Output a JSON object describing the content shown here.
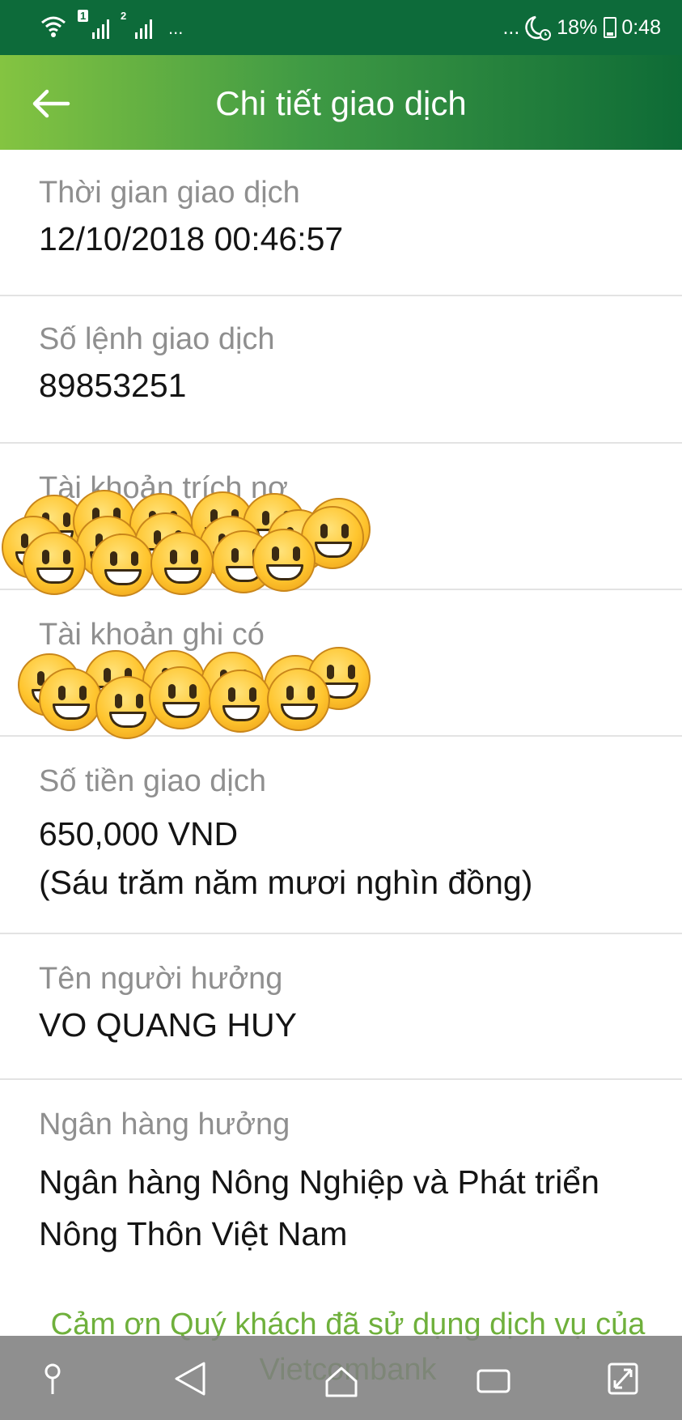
{
  "status_bar": {
    "sim1": "1",
    "sim2": "2",
    "left_dots": "...",
    "right_dots": "...",
    "battery_percent": "18%",
    "time": "0:48",
    "icons": [
      "wifi-icon",
      "signal-sim1-icon",
      "signal-sim2-icon",
      "moon-alarm-icon",
      "battery-icon"
    ]
  },
  "header": {
    "title": "Chi tiết giao dịch",
    "back_icon": "arrow-left-icon"
  },
  "details": {
    "time_label": "Thời gian giao dịch",
    "time_value": "12/10/2018 00:46:57",
    "order_label": "Số lệnh giao dịch",
    "order_value": "89853251",
    "debit_label": "Tài khoản trích nợ",
    "credit_label": "Tài khoản ghi có",
    "amount_label": "Số tiền giao dịch",
    "amount_value": "650,000 VND",
    "amount_words": "(Sáu trăm năm mươi nghìn đồng)",
    "beneficiary_label": "Tên người hưởng",
    "beneficiary_value": "VO QUANG HUY",
    "bank_label": "Ngân hàng hưởng",
    "bank_value": "Ngân hàng Nông Nghiệp và Phát triển Nông Thôn Việt Nam"
  },
  "redaction_icon": "grinning-face-emoji",
  "footer": {
    "thanks": "Cảm ơn Quý khách đã sử dụng dịch vụ của Vietcombank"
  },
  "nav_bar": {
    "icons": [
      "pin-icon",
      "back-triangle-icon",
      "home-icon",
      "recent-apps-icon",
      "expand-icon"
    ]
  },
  "colors": {
    "status_bar": "#0d6b3a",
    "header_start": "#84c441",
    "header_end": "#0e6b36",
    "label": "#8f8f8f",
    "thanks": "#6fb03c"
  }
}
